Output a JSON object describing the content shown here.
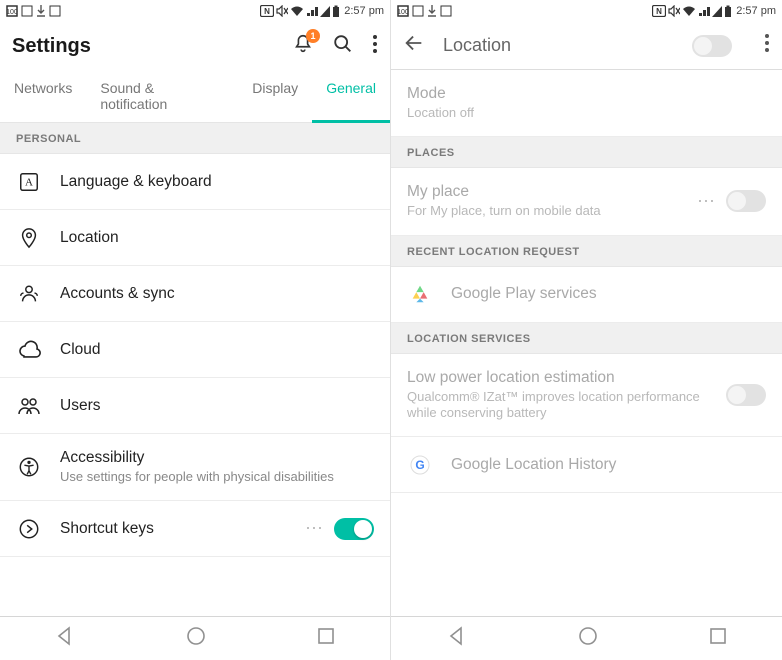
{
  "status": {
    "time": "2:57 pm",
    "battery": "100"
  },
  "left": {
    "title": "Settings",
    "badge_count": "1",
    "tabs": [
      "Networks",
      "Sound & notification",
      "Display",
      "General"
    ],
    "active_tab": 3,
    "sections": {
      "personal_header": "PERSONAL"
    },
    "items": {
      "language": {
        "label": "Language & keyboard"
      },
      "location": {
        "label": "Location"
      },
      "accounts": {
        "label": "Accounts & sync"
      },
      "cloud": {
        "label": "Cloud"
      },
      "users": {
        "label": "Users"
      },
      "accessibility": {
        "label": "Accessibility",
        "sub": "Use settings for people with physical disabilities"
      },
      "shortcut": {
        "label": "Shortcut keys",
        "toggle": true
      }
    }
  },
  "right": {
    "title": "Location",
    "master_toggle": false,
    "items": {
      "mode": {
        "label": "Mode",
        "sub": "Location off"
      },
      "places_header": "PLACES",
      "myplace": {
        "label": "My place",
        "sub": "For My place, turn on mobile data",
        "toggle": false
      },
      "recent_header": "RECENT LOCATION REQUEST",
      "play": {
        "label": "Google Play services"
      },
      "services_header": "LOCATION SERVICES",
      "lowpower": {
        "label": "Low power location estimation",
        "sub": "Qualcomm® IZat™ improves location performance while conserving battery",
        "toggle": false
      },
      "history": {
        "label": "Google Location History"
      }
    }
  }
}
